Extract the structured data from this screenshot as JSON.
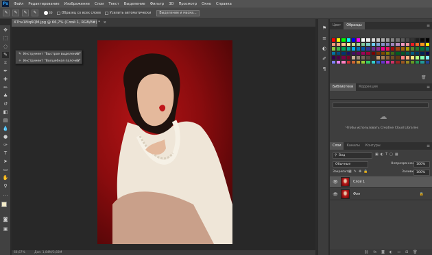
{
  "menu": {
    "logo": "Ps",
    "items": [
      "Файл",
      "Редактирование",
      "Изображение",
      "Слои",
      "Текст",
      "Выделение",
      "Фильтр",
      "3D",
      "Просмотр",
      "Окно",
      "Справка"
    ]
  },
  "options": {
    "brush_size": "30",
    "sample_all": "Образец со всех слоев",
    "auto_enhance": "Усилить автоматически",
    "refine": "Выделение и маска..."
  },
  "document": {
    "tab": "X7hv18iq6QM.jpg @ 66,7% (Слой 1, RGB/8#) *",
    "close": "×",
    "status": "66,67%"
  },
  "status": {
    "doc": "Док: 1,84M/3,68M"
  },
  "flyout": {
    "items": [
      {
        "label": "Инструмент \"Быстрое выделение\"",
        "key": "W"
      },
      {
        "label": "Инструмент \"Волшебная палочка\"",
        "key": "W"
      }
    ]
  },
  "color_panel": {
    "tabs": [
      "Цвет",
      "Образцы"
    ],
    "active": 1
  },
  "swatches": [
    "#ff0000",
    "#ffff00",
    "#00ff00",
    "#00ffff",
    "#0000ff",
    "#ff00ff",
    "#ffffff",
    "#ebebeb",
    "#d6d6d6",
    "#c2c2c2",
    "#adadad",
    "#999999",
    "#858585",
    "#707070",
    "#5c5c5c",
    "#474747",
    "#333333",
    "#1f1f1f",
    "#0a0a0a",
    "#000000",
    "#f7977a",
    "#f9ad81",
    "#fdc68a",
    "#fff79a",
    "#c4df9b",
    "#a2d39c",
    "#82ca9d",
    "#7bcdc8",
    "#6ecff6",
    "#7ea7d8",
    "#8493ca",
    "#8882be",
    "#a187be",
    "#bc8dbf",
    "#f49ac2",
    "#f6989d",
    "#ed1c24",
    "#f26522",
    "#f7941d",
    "#fff200",
    "#8dc73f",
    "#39b54a",
    "#00a651",
    "#00a99d",
    "#00aeef",
    "#0072bc",
    "#0054a6",
    "#2e3192",
    "#662d91",
    "#92278f",
    "#ec008c",
    "#ed145b",
    "#9e0b0f",
    "#a0410d",
    "#a36209",
    "#aba000",
    "#598527",
    "#197b30",
    "#007236",
    "#00746b",
    "#0076a3",
    "#004b80",
    "#003471",
    "#1b1464",
    "#440e62",
    "#630460",
    "#9e005d",
    "#9e0039",
    "#790000",
    "#7b2e00",
    "#7d4900",
    "#827b00",
    "#406618",
    "#005e20",
    "#005826",
    "#005952",
    "#005b7f",
    "#003663",
    "#002157",
    "#0d004c",
    "#32004b",
    "#4b0049",
    "#7b0046",
    "#7a0026",
    "#c7b299",
    "#998675",
    "#736357",
    "#534741",
    "#37302d",
    "#c69c6d",
    "#a67c52",
    "#8c6239",
    "#754c24",
    "#603913",
    "#ff8080",
    "#ffb380",
    "#ffe680",
    "#b3ff80",
    "#80ffb3",
    "#80e6ff",
    "#8080ff",
    "#e680ff",
    "#ff80c0",
    "#cc3333",
    "#cc6633",
    "#cc9933",
    "#99cc33",
    "#33cc66",
    "#33cccc",
    "#3366cc",
    "#6633cc",
    "#cc33cc",
    "#cc3366",
    "#992222",
    "#995522",
    "#998822",
    "#669922",
    "#229955",
    "#229999",
    "#224499"
  ],
  "libraries": {
    "tabs": [
      "Библиотеки",
      "Коррекция"
    ],
    "active": 0,
    "message": "Чтобы использовать Creative Cloud Libraries"
  },
  "layers": {
    "tabs": [
      "Слои",
      "Каналы",
      "Контуры"
    ],
    "active": 0,
    "kind": "Вид",
    "blend": "Обычные",
    "opacity_label": "Непрозрачность:",
    "opacity": "100%",
    "lock_label": "Закрепить:",
    "fill_label": "Заливка:",
    "fill": "100%",
    "items": [
      {
        "name": "Слой 1",
        "selected": true
      },
      {
        "name": "Фон",
        "selected": false
      }
    ]
  }
}
